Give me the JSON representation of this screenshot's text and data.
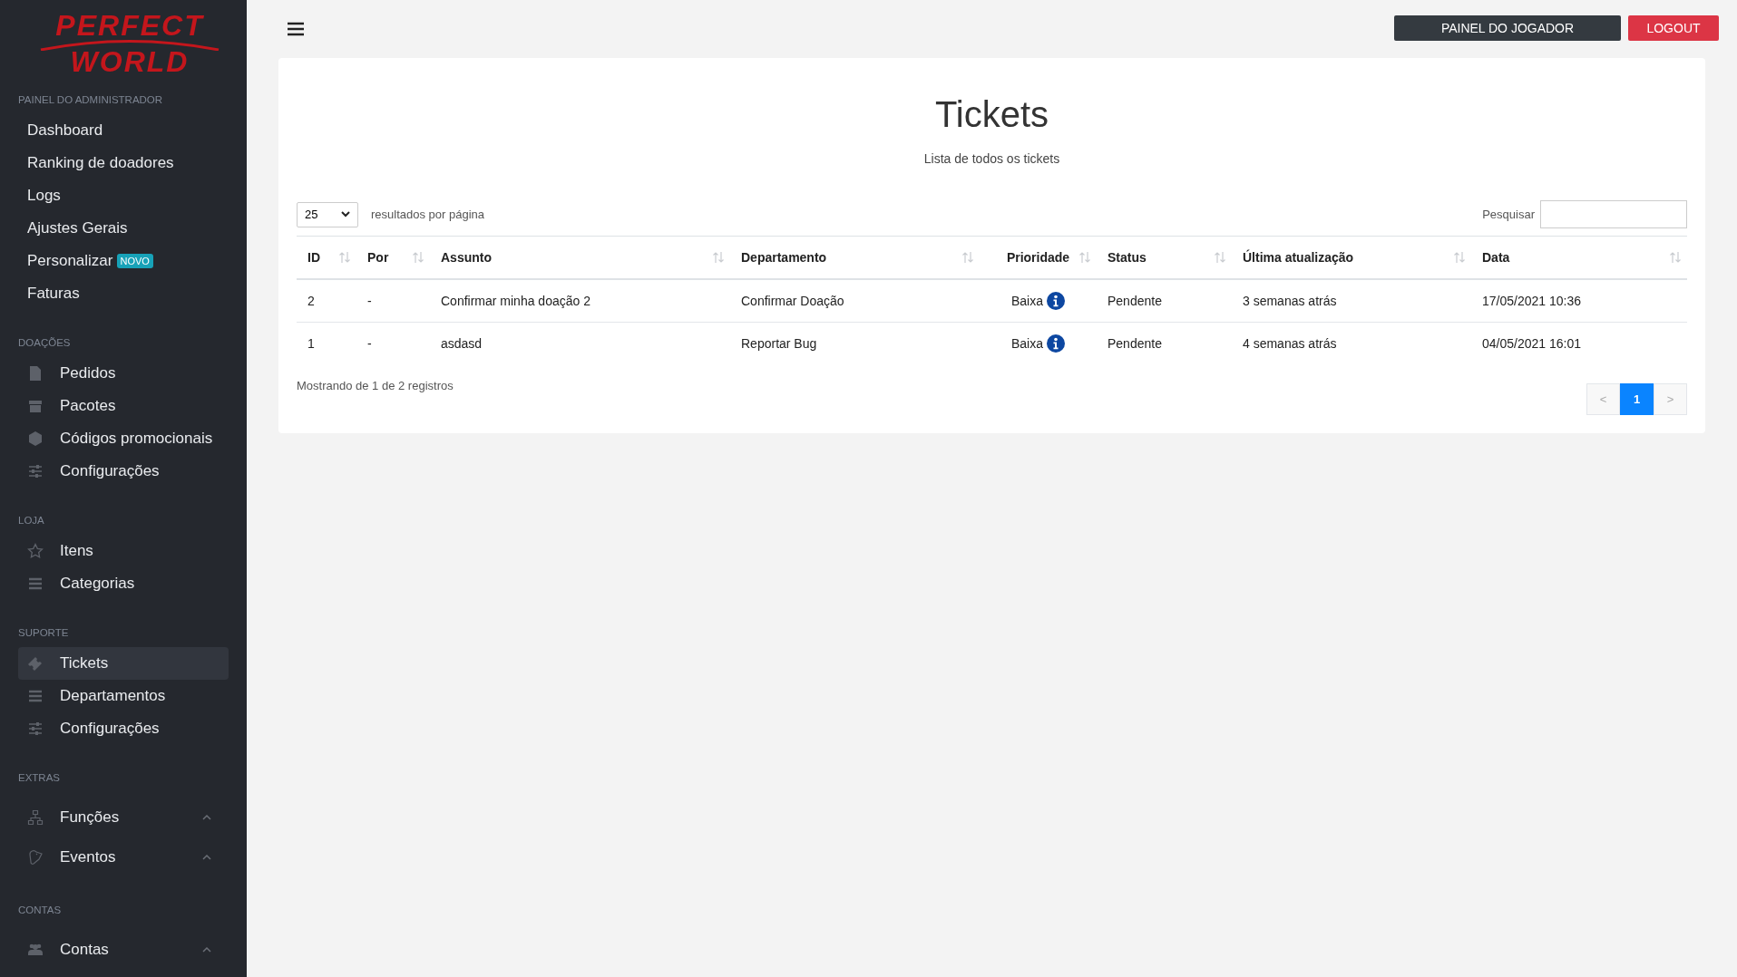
{
  "logo": {
    "line_1": "PERFECT",
    "line_2": "WORLD"
  },
  "sidebar": {
    "sections": [
      {
        "title": "PAINEL DO ADMINISTRADOR",
        "items": [
          {
            "label": "Dashboard",
            "kind": "plain",
            "selected": false
          },
          {
            "label": "Ranking de doadores",
            "kind": "plain",
            "selected": false
          },
          {
            "label": "Logs",
            "kind": "plain",
            "selected": false
          },
          {
            "label": "Ajustes Gerais",
            "kind": "plain",
            "selected": false
          },
          {
            "label": "Personalizar",
            "kind": "plain",
            "selected": false,
            "badge": "NOVO"
          },
          {
            "label": "Faturas",
            "kind": "plain",
            "selected": false
          }
        ]
      },
      {
        "title": "DOAÇÕES",
        "items": [
          {
            "label": "Pedidos",
            "kind": "icon",
            "selected": false
          },
          {
            "label": "Pacotes",
            "kind": "icon",
            "selected": false
          },
          {
            "label": "Códigos promocionais",
            "kind": "icon",
            "selected": false
          },
          {
            "label": "Configurações",
            "kind": "icon",
            "selected": false
          }
        ]
      },
      {
        "title": "LOJA",
        "items": [
          {
            "label": "Itens",
            "kind": "icon",
            "selected": false
          },
          {
            "label": "Categorias",
            "kind": "icon",
            "selected": false
          }
        ]
      },
      {
        "title": "SUPORTE",
        "items": [
          {
            "label": "Tickets",
            "kind": "icon",
            "selected": true
          },
          {
            "label": "Departamentos",
            "kind": "icon",
            "selected": false
          },
          {
            "label": "Configurações",
            "kind": "icon",
            "selected": false
          }
        ]
      },
      {
        "title": "EXTRAS",
        "items": [
          {
            "label": "Funções",
            "kind": "expandable",
            "selected": false,
            "expanded": false
          },
          {
            "label": "Eventos",
            "kind": "expandable",
            "selected": false,
            "expanded": false
          }
        ]
      },
      {
        "title": "CONTAS",
        "items": [
          {
            "label": "Contas",
            "kind": "expandable",
            "selected": false,
            "expanded": false
          }
        ]
      }
    ]
  },
  "header": {
    "buttons": [
      {
        "label": "PAINEL DO JOGADOR",
        "kind": "dark"
      },
      {
        "label": "LOGOUT",
        "kind": "danger"
      }
    ]
  },
  "page": {
    "title": "Tickets",
    "subtitle": "Lista de todos os tickets"
  },
  "table_controls": {
    "page_size": "25",
    "page_size_label": "resultados por página",
    "search_label": "Pesquisar"
  },
  "table": {
    "columns": [
      "ID",
      "Por",
      "Assunto",
      "Departamento",
      "Prioridade",
      "Status",
      "Última atualização",
      "Data"
    ],
    "rows": [
      [
        "2",
        "-",
        "Confirmar minha doação 2",
        "Confirmar Doação",
        "Baixa",
        "Pendente",
        "3 semanas atrás",
        "17/05/2021 10:36"
      ],
      [
        "1",
        "-",
        "asdasd",
        "Reportar Bug",
        "Baixa",
        "Pendente",
        "4 semanas atrás",
        "04/05/2021 16:01"
      ]
    ]
  },
  "footer": {
    "info": "Mostrando de 1 de 2 registros",
    "pagination": [
      {
        "label": "<",
        "kind": "prev",
        "selected": false,
        "disabled": true
      },
      {
        "label": "1",
        "kind": "page",
        "selected": true,
        "disabled": false
      },
      {
        "label": ">",
        "kind": "next",
        "selected": false,
        "disabled": true
      }
    ]
  }
}
